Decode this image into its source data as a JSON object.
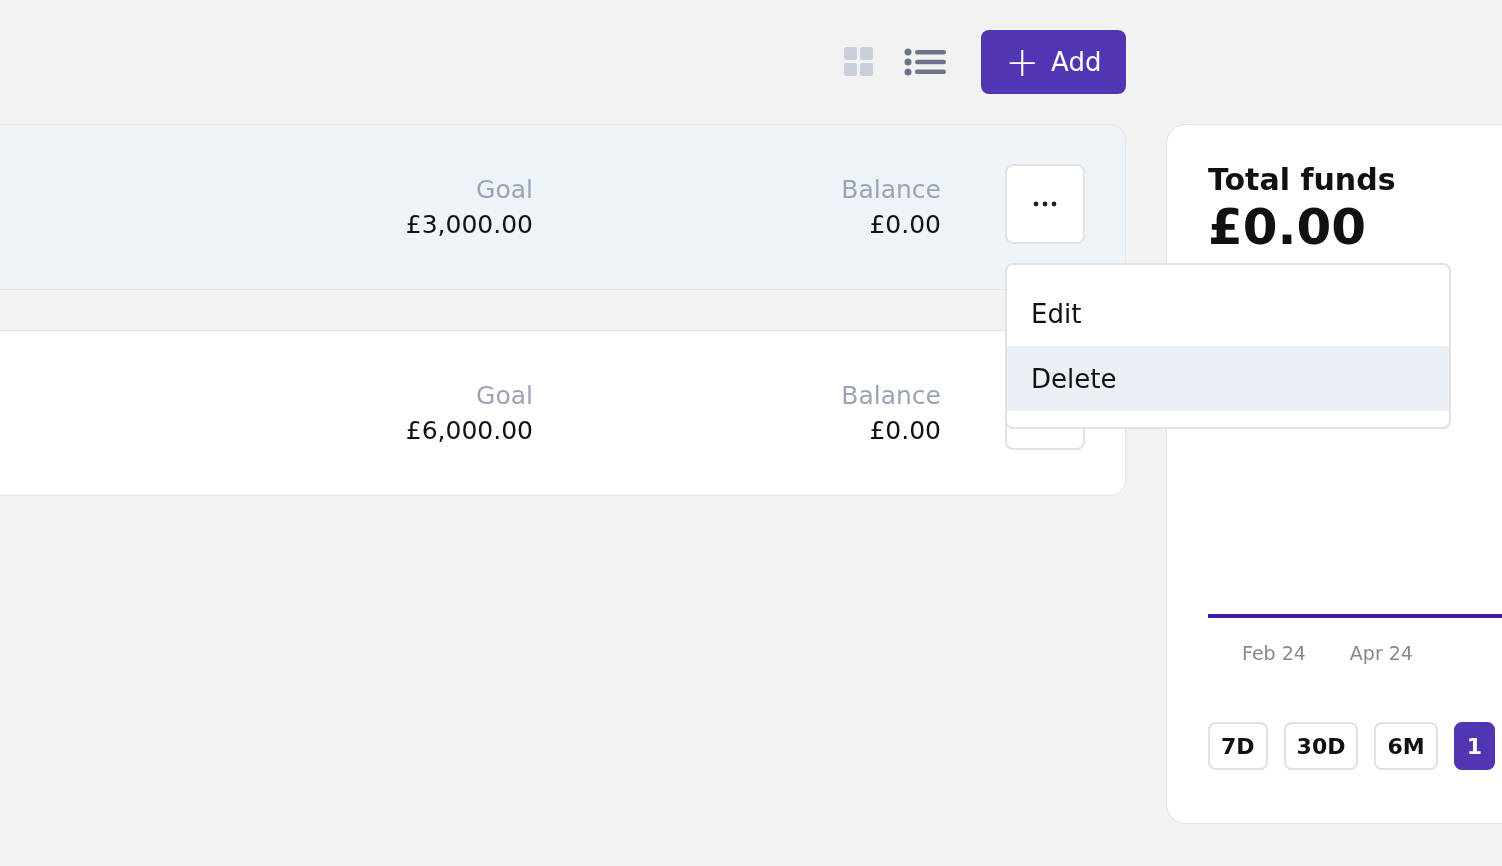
{
  "toolbar": {
    "views": [
      {
        "kind": "grid",
        "selected": false
      },
      {
        "kind": "list",
        "selected": true
      }
    ],
    "add_button": {
      "icon": "+",
      "label": "Add"
    }
  },
  "goals": [
    {
      "goal_label": "Goal",
      "goal": "£3,000.00",
      "balance_label": "Balance",
      "balance": "£0.00",
      "selected": true
    },
    {
      "goal_label": "Goal",
      "goal": "£6,000.00",
      "balance_label": "Balance",
      "balance": "£0.00",
      "selected": false
    }
  ],
  "menu": [
    {
      "label": "Edit",
      "selected": false
    },
    {
      "label": "Delete",
      "selected": true
    }
  ],
  "summary": {
    "title": "Total funds",
    "amount": "£0.00",
    "axis_labels": [
      "Feb 24",
      "Apr 24"
    ],
    "ranges": [
      {
        "label": "7D",
        "selected": false
      },
      {
        "label": "30D",
        "selected": false
      },
      {
        "label": "6M",
        "selected": false
      },
      {
        "label": "1",
        "selected": true
      }
    ]
  }
}
